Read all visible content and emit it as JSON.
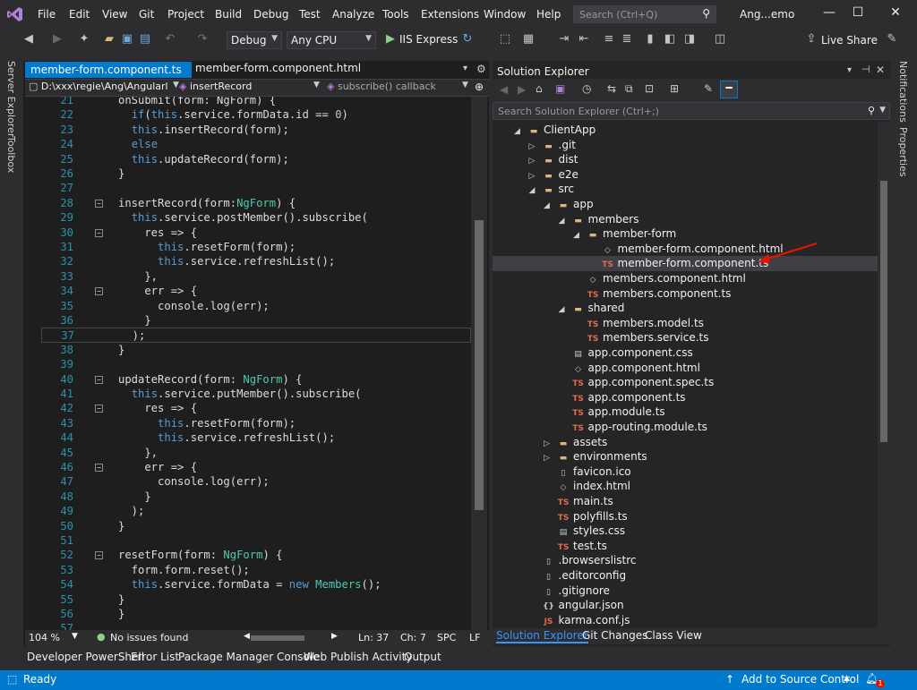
{
  "menu": {
    "items": [
      "File",
      "Edit",
      "View",
      "Git",
      "Project",
      "Build",
      "Debug",
      "Test",
      "Analyze",
      "Tools",
      "Extensions",
      "Window",
      "Help"
    ],
    "search_placeholder": "Search (Ctrl+Q)",
    "window_title": "Ang...emo"
  },
  "toolbar": {
    "config": "Debug",
    "platform": "Any CPU",
    "run_label": "IIS Express",
    "live_share": "Live Share"
  },
  "left_strip": {
    "server_explorer": "Server Explorer",
    "toolbox": "Toolbox"
  },
  "right_strip": {
    "notifications": "Notifications",
    "properties": "Properties"
  },
  "editor": {
    "tabs": [
      {
        "label": "member-form.component.ts",
        "pin": "⊣",
        "close": "×"
      },
      {
        "label": "member-form.component.html"
      }
    ],
    "nav": {
      "path": "D:\\xxx\\regie\\Ang\\Angularl",
      "member": "insertRecord",
      "callback": "subscribe() callback"
    },
    "status": {
      "zoom": "104 %",
      "issues": "No issues found",
      "ln": "Ln: 37",
      "ch": "Ch: 7",
      "spc": "SPC",
      "eol": "LF"
    },
    "lines": [
      {
        "n": "21",
        "fold": "",
        "html": "onSubmit(form: NgForm) {"
      },
      {
        "n": "22",
        "fold": "",
        "html": "  <span class='kw'>if</span>(<span class='kw'>this</span>.service.formData.id == <span class='num'>0</span>)"
      },
      {
        "n": "23",
        "fold": "",
        "html": "  <span class='kw'>this</span>.insertRecord(form);"
      },
      {
        "n": "24",
        "fold": "",
        "html": "  <span class='kw'>else</span>"
      },
      {
        "n": "25",
        "fold": "",
        "html": "  <span class='kw'>this</span>.updateRecord(form);"
      },
      {
        "n": "26",
        "fold": "",
        "html": "}"
      },
      {
        "n": "27",
        "fold": "",
        "html": ""
      },
      {
        "n": "28",
        "fold": "−",
        "html": "insertRecord(form:<span class='ty'>NgForm</span>) {"
      },
      {
        "n": "29",
        "fold": "",
        "html": "  <span class='kw'>this</span>.service.postMember().subscribe("
      },
      {
        "n": "30",
        "fold": "−",
        "html": "    res => {"
      },
      {
        "n": "31",
        "fold": "",
        "html": "      <span class='kw'>this</span>.resetForm(form);"
      },
      {
        "n": "32",
        "fold": "",
        "html": "      <span class='kw'>this</span>.service.refreshList();"
      },
      {
        "n": "33",
        "fold": "",
        "html": "    },"
      },
      {
        "n": "34",
        "fold": "−",
        "html": "    err => {"
      },
      {
        "n": "35",
        "fold": "",
        "html": "      console.log(err);"
      },
      {
        "n": "36",
        "fold": "",
        "html": "    }"
      },
      {
        "n": "37",
        "fold": "",
        "html": "  );"
      },
      {
        "n": "38",
        "fold": "",
        "html": "}"
      },
      {
        "n": "39",
        "fold": "",
        "html": ""
      },
      {
        "n": "40",
        "fold": "−",
        "html": "updateRecord(form: <span class='ty'>NgForm</span>) {"
      },
      {
        "n": "41",
        "fold": "",
        "html": "  <span class='kw'>this</span>.service.putMember().subscribe("
      },
      {
        "n": "42",
        "fold": "−",
        "html": "    res => {"
      },
      {
        "n": "43",
        "fold": "",
        "html": "      <span class='kw'>this</span>.resetForm(form);"
      },
      {
        "n": "44",
        "fold": "",
        "html": "      <span class='kw'>this</span>.service.refreshList();"
      },
      {
        "n": "45",
        "fold": "",
        "html": "    },"
      },
      {
        "n": "46",
        "fold": "−",
        "html": "    err => {"
      },
      {
        "n": "47",
        "fold": "",
        "html": "      console.log(err);"
      },
      {
        "n": "48",
        "fold": "",
        "html": "    }"
      },
      {
        "n": "49",
        "fold": "",
        "html": "  );"
      },
      {
        "n": "50",
        "fold": "",
        "html": "}"
      },
      {
        "n": "51",
        "fold": "",
        "html": ""
      },
      {
        "n": "52",
        "fold": "−",
        "html": "resetForm(form: <span class='ty'>NgForm</span>) {"
      },
      {
        "n": "53",
        "fold": "",
        "html": "  form.form.reset();"
      },
      {
        "n": "54",
        "fold": "",
        "html": "  <span class='kw'>this</span>.service.formData = <span class='kw'>new</span> <span class='ty'>Members</span>();"
      },
      {
        "n": "55",
        "fold": "",
        "html": "}"
      },
      {
        "n": "56",
        "fold": "",
        "html": "}"
      },
      {
        "n": "57",
        "fold": "",
        "html": ""
      }
    ]
  },
  "solution": {
    "title": "Solution Explorer",
    "search_placeholder": "Search Solution Explorer (Ctrl+;)",
    "tree": [
      {
        "label": "ClientApp",
        "depth": 1,
        "exp": "◢",
        "icon": "folder"
      },
      {
        "label": ".git",
        "depth": 2,
        "exp": "▷",
        "icon": "folder"
      },
      {
        "label": "dist",
        "depth": 2,
        "exp": "▷",
        "icon": "folder"
      },
      {
        "label": "e2e",
        "depth": 2,
        "exp": "▷",
        "icon": "folder"
      },
      {
        "label": "src",
        "depth": 2,
        "exp": "◢",
        "icon": "folder"
      },
      {
        "label": "app",
        "depth": 3,
        "exp": "◢",
        "icon": "folder"
      },
      {
        "label": "members",
        "depth": 4,
        "exp": "◢",
        "icon": "folder"
      },
      {
        "label": "member-form",
        "depth": 5,
        "exp": "◢",
        "icon": "folder"
      },
      {
        "label": "member-form.component.html",
        "depth": 6,
        "exp": "",
        "icon": "html"
      },
      {
        "label": "member-form.component.ts",
        "depth": 6,
        "exp": "",
        "icon": "ts",
        "selected": true
      },
      {
        "label": "members.component.html",
        "depth": 5,
        "exp": "",
        "icon": "html"
      },
      {
        "label": "members.component.ts",
        "depth": 5,
        "exp": "",
        "icon": "ts"
      },
      {
        "label": "shared",
        "depth": 4,
        "exp": "◢",
        "icon": "folder"
      },
      {
        "label": "members.model.ts",
        "depth": 5,
        "exp": "",
        "icon": "ts"
      },
      {
        "label": "members.service.ts",
        "depth": 5,
        "exp": "",
        "icon": "ts"
      },
      {
        "label": "app.component.css",
        "depth": 4,
        "exp": "",
        "icon": "css"
      },
      {
        "label": "app.component.html",
        "depth": 4,
        "exp": "",
        "icon": "html"
      },
      {
        "label": "app.component.spec.ts",
        "depth": 4,
        "exp": "",
        "icon": "ts"
      },
      {
        "label": "app.component.ts",
        "depth": 4,
        "exp": "",
        "icon": "ts"
      },
      {
        "label": "app.module.ts",
        "depth": 4,
        "exp": "",
        "icon": "ts"
      },
      {
        "label": "app-routing.module.ts",
        "depth": 4,
        "exp": "",
        "icon": "ts"
      },
      {
        "label": "assets",
        "depth": 3,
        "exp": "▷",
        "icon": "folder"
      },
      {
        "label": "environments",
        "depth": 3,
        "exp": "▷",
        "icon": "folder"
      },
      {
        "label": "favicon.ico",
        "depth": 3,
        "exp": "",
        "icon": "file"
      },
      {
        "label": "index.html",
        "depth": 3,
        "exp": "",
        "icon": "html"
      },
      {
        "label": "main.ts",
        "depth": 3,
        "exp": "",
        "icon": "ts"
      },
      {
        "label": "polyfills.ts",
        "depth": 3,
        "exp": "",
        "icon": "ts"
      },
      {
        "label": "styles.css",
        "depth": 3,
        "exp": "",
        "icon": "css"
      },
      {
        "label": "test.ts",
        "depth": 3,
        "exp": "",
        "icon": "ts"
      },
      {
        "label": ".browserslistrc",
        "depth": 2,
        "exp": "",
        "icon": "file"
      },
      {
        "label": ".editorconfig",
        "depth": 2,
        "exp": "",
        "icon": "file"
      },
      {
        "label": ".gitignore",
        "depth": 2,
        "exp": "",
        "icon": "file"
      },
      {
        "label": "angular.json",
        "depth": 2,
        "exp": "",
        "icon": "json"
      },
      {
        "label": "karma.conf.js",
        "depth": 2,
        "exp": "",
        "icon": "js"
      }
    ],
    "bottom_tabs": [
      "Solution Explorer",
      "Git Changes",
      "Class View"
    ]
  },
  "bottom_panels": [
    "Developer PowerShell",
    "Error List",
    "Package Manager Console",
    "Web Publish Activity",
    "Output"
  ],
  "statusbar": {
    "ready": "Ready",
    "source_control": "Add to Source Control",
    "notif_count": "1"
  },
  "colors": {
    "accent": "#007acc",
    "bg": "#2d2d30",
    "editor_bg": "#1e1e1e",
    "arrow_red": "#e51400"
  }
}
